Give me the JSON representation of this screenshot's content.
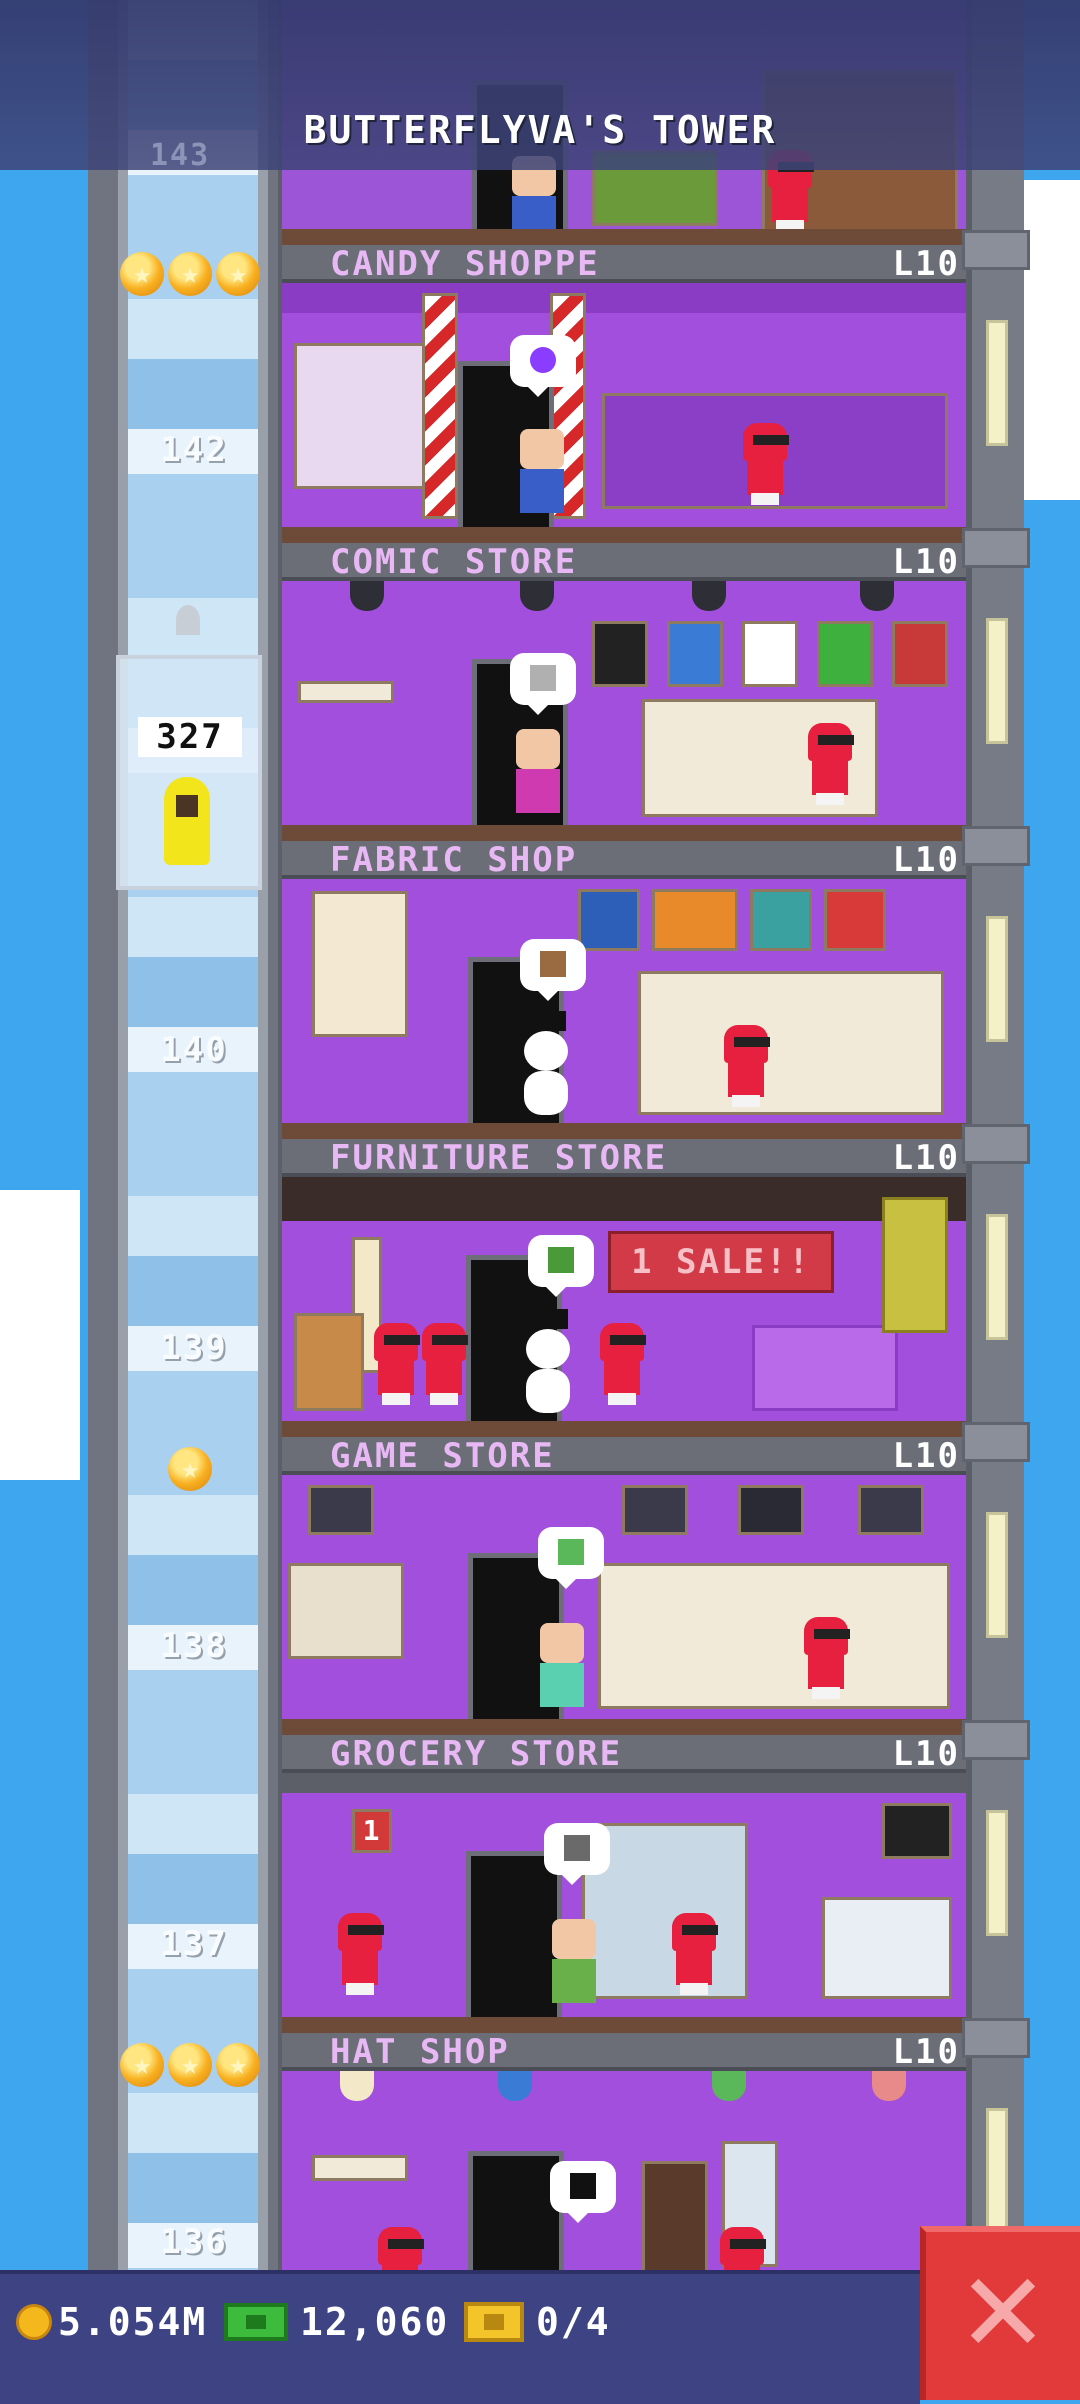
{
  "tower": {
    "title": "BUTTERFLYVA'S TOWER",
    "top_floor_number": "143"
  },
  "elevator": {
    "counter": "327",
    "floor_numbers": [
      "142",
      "140",
      "139",
      "138",
      "137",
      "136"
    ]
  },
  "floors": [
    {
      "name": "CANDY SHOPPE",
      "level": "L10",
      "stars": 3
    },
    {
      "name": "COMIC STORE",
      "level": "L10",
      "stars": 0
    },
    {
      "name": "FABRIC SHOP",
      "level": "L10",
      "stars": 0
    },
    {
      "name": "FURNITURE STORE",
      "level": "L10",
      "stars": 0
    },
    {
      "name": "GAME STORE",
      "level": "L10",
      "stars": 1
    },
    {
      "name": "GROCERY STORE",
      "level": "L10",
      "stars": 0
    },
    {
      "name": "HAT SHOP",
      "level": "L10",
      "stars": 3
    }
  ],
  "furniture_sign": "1 SALE!!",
  "grocery_aisle_sign": "1",
  "status_bar": {
    "coins": "5.054M",
    "bux": "12,060",
    "tickets": "0/4"
  },
  "icons": {
    "coin": "coin-icon",
    "bux": "cash-icon",
    "tickets": "ticket-icon",
    "close": "close-icon",
    "star": "star-icon"
  },
  "colors": {
    "sky": "#3ea6ee",
    "room_purple": "#a24fdd",
    "floor_name": "#e7b8f4",
    "close_red": "#e23a3a"
  }
}
